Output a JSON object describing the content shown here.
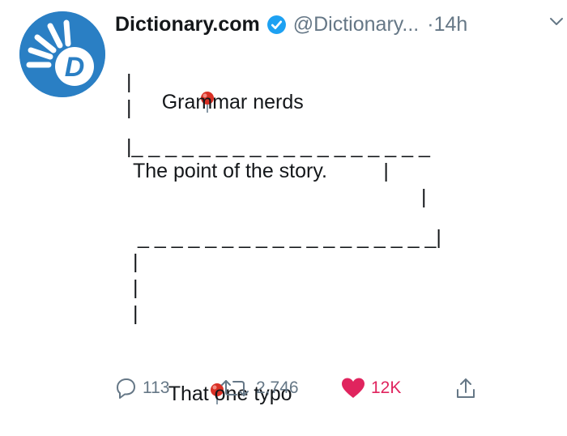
{
  "tweet": {
    "display_name": "Dictionary.com",
    "handle": "@Dictionary...",
    "time": "·14h",
    "lines": [
      "Grammar nerds",
      "|",
      "|",
      "|_ _ _ _ _ _ _ _ _ _ _ _ _ _ _ _ _ _",
      "The point of the story.          |",
      "|",
      "_ _ _ _ _ _ _ _ _ _ _ _ _ _ _ _ _ _|",
      "|",
      "|",
      "|",
      "That one typo"
    ]
  },
  "actions": {
    "reply_count": "113",
    "retweet_count": "2,746",
    "like_count": "12K"
  },
  "icons": {
    "avatar": "dictionary-logo",
    "verified": "verified-badge-icon",
    "caret": "chevron-down-icon",
    "pin": "round-pushpin-icon",
    "reply": "reply-icon",
    "retweet": "retweet-icon",
    "like": "heart-icon",
    "share": "share-icon"
  },
  "colors": {
    "brand": "#2a7fc4",
    "verified": "#1da1f2",
    "muted": "#657786",
    "like": "#e0245e",
    "pin": "#d93025"
  }
}
